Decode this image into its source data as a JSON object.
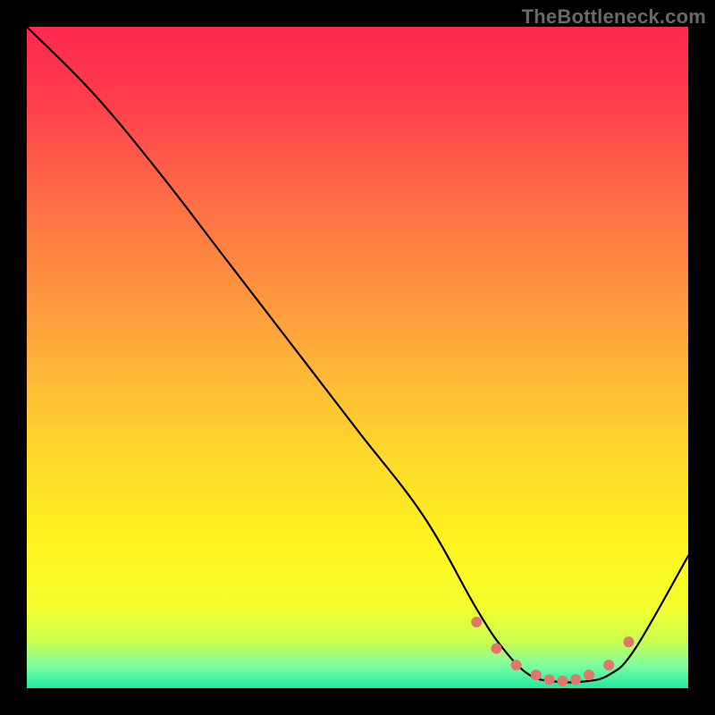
{
  "watermark": "TheBottleneck.com",
  "chart_data": {
    "type": "line",
    "title": "",
    "xlabel": "",
    "ylabel": "",
    "xlim": [
      0,
      100
    ],
    "ylim": [
      0,
      100
    ],
    "grid": false,
    "legend": false,
    "series": [
      {
        "name": "bottleneck-curve",
        "x": [
          0,
          10,
          20,
          30,
          40,
          50,
          60,
          68,
          72,
          76,
          80,
          84,
          88,
          92,
          100
        ],
        "y": [
          100,
          90,
          78,
          65,
          52,
          39,
          26,
          12,
          6,
          2,
          1,
          1,
          2,
          6,
          20
        ]
      }
    ],
    "highlight": {
      "name": "optimal-range",
      "points_x": [
        68,
        71,
        74,
        77,
        79,
        81,
        83,
        85,
        88,
        91
      ],
      "points_y": [
        10,
        6,
        3.5,
        2,
        1.3,
        1.1,
        1.3,
        2,
        3.5,
        7
      ],
      "color": "#e0766c",
      "radius": 6
    },
    "background_gradient": {
      "stops": [
        {
          "offset": 0.0,
          "color": "#ff2850"
        },
        {
          "offset": 0.1,
          "color": "#ff3a4c"
        },
        {
          "offset": 0.25,
          "color": "#ff6a46"
        },
        {
          "offset": 0.45,
          "color": "#ffa23c"
        },
        {
          "offset": 0.62,
          "color": "#ffd22e"
        },
        {
          "offset": 0.78,
          "color": "#fff41e"
        },
        {
          "offset": 0.88,
          "color": "#f4ff2e"
        },
        {
          "offset": 0.93,
          "color": "#c8ff50"
        },
        {
          "offset": 0.965,
          "color": "#7effa0"
        },
        {
          "offset": 1.0,
          "color": "#20e9a0"
        }
      ]
    }
  }
}
